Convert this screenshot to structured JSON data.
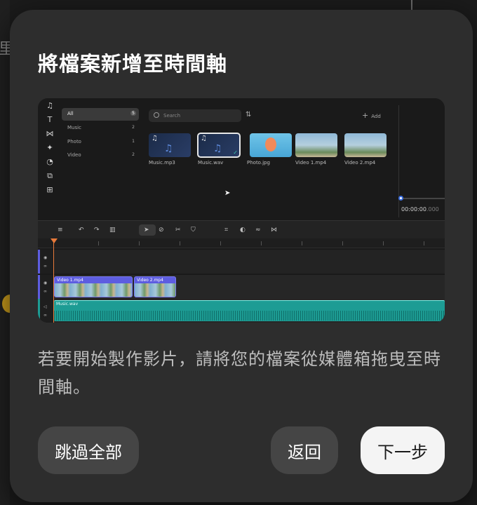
{
  "dialog": {
    "title": "將檔案新增至時間軸",
    "description": "若要開始製作影片，請將您的檔案從媒體箱拖曳至時間軸。",
    "buttons": {
      "skip": "跳過全部",
      "back": "返回",
      "next": "下一步"
    }
  },
  "backdrop": {
    "glyph": "里"
  },
  "preview": {
    "categories": [
      {
        "name": "All",
        "count": "5"
      },
      {
        "name": "Music",
        "count": "2"
      },
      {
        "name": "Photo",
        "count": "1"
      },
      {
        "name": "Video",
        "count": "2"
      }
    ],
    "search_placeholder": "Search",
    "add_label": "Add",
    "media": [
      "Music.mp3",
      "Music.wav",
      "Photo.jpg",
      "Video 1.mp4",
      "Video 2.mp4"
    ],
    "timecode": "00:00:00",
    "timecode_frames": ".000",
    "clips": {
      "video1": "Video 1.mp4",
      "video2": "Video 2.mp4",
      "audio": "Music.wav"
    }
  },
  "colors": {
    "accent_next": "#f4f4f4",
    "playhead": "#e87a3a",
    "video_clip": "#5d5de0",
    "audio_clip": "#1d9c94"
  }
}
